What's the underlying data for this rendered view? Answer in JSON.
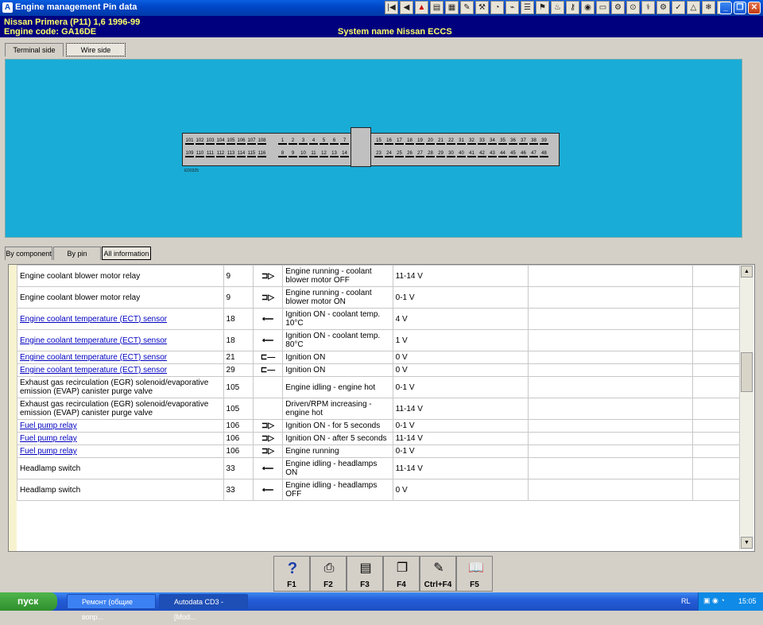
{
  "window": {
    "title": "Engine management Pin data"
  },
  "header": {
    "vehicle": "Nissan   Primera (P11) 1,6  1996-99",
    "engine_code": "Engine code: GA16DE",
    "system_name": "System name Nissan ECCS"
  },
  "view_tabs": [
    {
      "label": "Terminal side"
    },
    {
      "label": "Wire side"
    }
  ],
  "connector": {
    "row1_left": [
      "101",
      "102",
      "103",
      "104",
      "105",
      "106",
      "107",
      "108"
    ],
    "row1_mid": [
      "1",
      "2",
      "3",
      "4",
      "5",
      "6",
      "7"
    ],
    "row1_right": [
      "15",
      "16",
      "17",
      "18",
      "19",
      "20",
      "21",
      "22",
      "31",
      "32",
      "33",
      "34",
      "35",
      "36",
      "37",
      "38",
      "39"
    ],
    "row2_left": [
      "109",
      "110",
      "111",
      "112",
      "113",
      "114",
      "115",
      "116"
    ],
    "row2_mid": [
      "8",
      "9",
      "10",
      "11",
      "12",
      "13",
      "14"
    ],
    "row2_right": [
      "23",
      "24",
      "25",
      "26",
      "27",
      "28",
      "29",
      "30",
      "40",
      "41",
      "42",
      "43",
      "44",
      "45",
      "46",
      "47",
      "48"
    ],
    "label": "ED0325"
  },
  "info_tabs": [
    {
      "label": "By component"
    },
    {
      "label": "By pin number"
    },
    {
      "label": "All information"
    }
  ],
  "rows": [
    {
      "component": "Engine coolant blower motor relay",
      "link": false,
      "pin": "9",
      "signal": "out",
      "condition": "Engine running - coolant blower motor OFF",
      "value": "11-14 V"
    },
    {
      "component": "Engine coolant blower motor relay",
      "link": false,
      "pin": "9",
      "signal": "out",
      "condition": "Engine running - coolant blower motor ON",
      "value": "0-1 V"
    },
    {
      "component": "Engine coolant temperature (ECT) sensor",
      "link": true,
      "pin": "18",
      "signal": "in",
      "condition": "Ignition ON - coolant temp. 10°C",
      "value": "4 V"
    },
    {
      "component": "Engine coolant temperature (ECT) sensor",
      "link": true,
      "pin": "18",
      "signal": "in",
      "condition": "Ignition ON - coolant temp. 80°C",
      "value": "1 V"
    },
    {
      "component": "Engine coolant temperature (ECT) sensor",
      "link": true,
      "pin": "21",
      "signal": "ground",
      "condition": "Ignition ON",
      "value": "0 V"
    },
    {
      "component": "Engine coolant temperature (ECT) sensor",
      "link": true,
      "pin": "29",
      "signal": "ground",
      "condition": "Ignition ON",
      "value": "0 V"
    },
    {
      "component": "Exhaust gas recirculation (EGR) solenoid/evaporative emission (EVAP) canister purge valve",
      "link": false,
      "pin": "105",
      "signal": "",
      "condition": "Engine idling - engine hot",
      "value": "0-1 V"
    },
    {
      "component": "Exhaust gas recirculation (EGR) solenoid/evaporative emission (EVAP) canister purge valve",
      "link": false,
      "pin": "105",
      "signal": "",
      "condition": "Driven/RPM increasing - engine hot",
      "value": "11-14 V"
    },
    {
      "component": "Fuel pump relay",
      "link": true,
      "pin": "106",
      "signal": "out",
      "condition": "Ignition ON - for 5 seconds",
      "value": "0-1 V"
    },
    {
      "component": "Fuel pump relay",
      "link": true,
      "pin": "106",
      "signal": "out",
      "condition": "Ignition ON - after 5 seconds",
      "value": "11-14 V"
    },
    {
      "component": "Fuel pump relay",
      "link": true,
      "pin": "106",
      "signal": "out",
      "condition": "Engine running",
      "value": "0-1 V"
    },
    {
      "component": "Headlamp switch",
      "link": false,
      "pin": "33",
      "signal": "in",
      "condition": "Engine idling - headlamps ON",
      "value": "11-14 V"
    },
    {
      "component": "Headlamp switch",
      "link": false,
      "pin": "33",
      "signal": "in",
      "condition": "Engine idling - headlamps OFF",
      "value": "0 V"
    }
  ],
  "function_keys": [
    {
      "label": "F1",
      "icon": "help-icon"
    },
    {
      "label": "F2",
      "icon": "printer-icon"
    },
    {
      "label": "F3",
      "icon": "print-preview-icon"
    },
    {
      "label": "F4",
      "icon": "copy-icon"
    },
    {
      "label": "Ctrl+F4",
      "icon": "notes-icon"
    },
    {
      "label": "F5",
      "icon": "book-icon"
    }
  ],
  "taskbar": {
    "start": "пуск",
    "tasks": [
      {
        "label": "Ремонт (общие вопр..."
      },
      {
        "label": "Autodata CD3 - [Mod..."
      }
    ],
    "lang": "RL",
    "clock": "15:05"
  }
}
